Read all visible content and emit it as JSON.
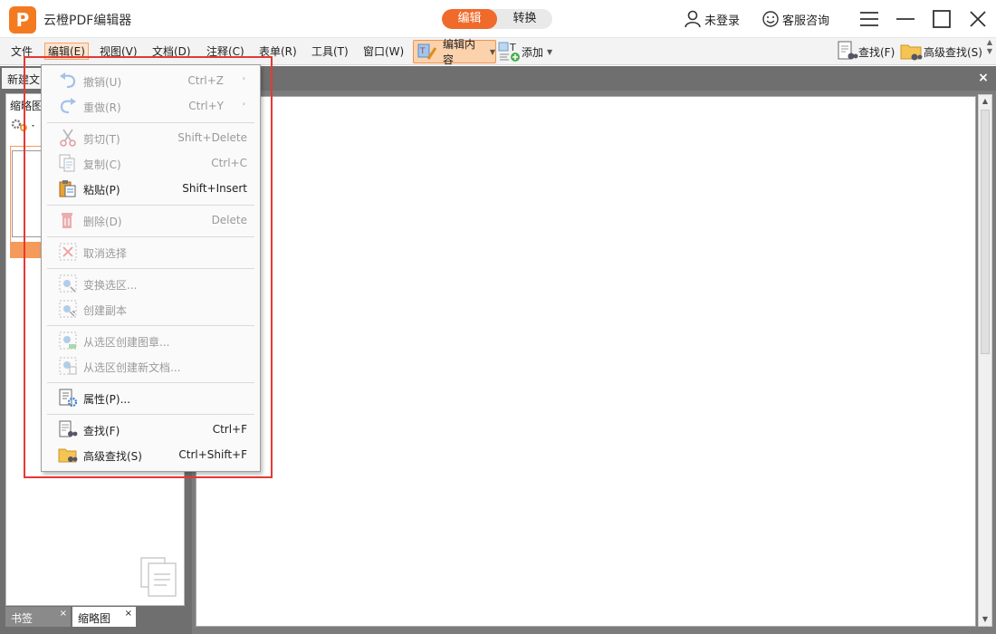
{
  "app": {
    "logo_letter": "P",
    "title": "云橙PDF编辑器"
  },
  "mode_switch": {
    "edit": "编辑",
    "convert": "转换"
  },
  "title_right": {
    "login": "未登录",
    "support": "客服咨询"
  },
  "menubar": {
    "file": "文件",
    "edit": "编辑(E)",
    "view": "视图(V)",
    "document": "文档(D)",
    "comment": "注释(C)",
    "form": "表单(R)",
    "tools": "工具(T)",
    "window": "窗口(W)",
    "edit_content": "编辑内容",
    "add": "添加",
    "find": "查找(F)",
    "advanced_find": "高级查找(S)"
  },
  "doc_tab": {
    "label": "新建文"
  },
  "left_panel": {
    "title": "缩略图",
    "bookmarks_tab": "书签",
    "thumbnails_tab": "缩略图",
    "close": "×"
  },
  "close_all": "×",
  "edit_menu": {
    "items": [
      {
        "label": "撤销(U)",
        "shortcut": "Ctrl+Z",
        "sub": "›"
      },
      {
        "label": "重做(R)",
        "shortcut": "Ctrl+Y",
        "sub": "›"
      },
      {
        "label": "剪切(T)",
        "shortcut": "Shift+Delete"
      },
      {
        "label": "复制(C)",
        "shortcut": "Ctrl+C"
      },
      {
        "label": "粘贴(P)",
        "shortcut": "Shift+Insert"
      },
      {
        "label": "删除(D)",
        "shortcut": "Delete"
      },
      {
        "label": "取消选择",
        "shortcut": ""
      },
      {
        "label": "变换选区...",
        "shortcut": ""
      },
      {
        "label": "创建副本",
        "shortcut": ""
      },
      {
        "label": "从选区创建图章...",
        "shortcut": ""
      },
      {
        "label": "从选区创建新文档...",
        "shortcut": ""
      },
      {
        "label": "属性(P)...",
        "shortcut": ""
      },
      {
        "label": "查找(F)",
        "shortcut": "Ctrl+F"
      },
      {
        "label": "高级查找(S)",
        "shortcut": "Ctrl+Shift+F"
      }
    ]
  },
  "colors": {
    "accent": "#f06a2b",
    "highlight": "#e53935",
    "panel_bg": "#6f6f6f"
  }
}
